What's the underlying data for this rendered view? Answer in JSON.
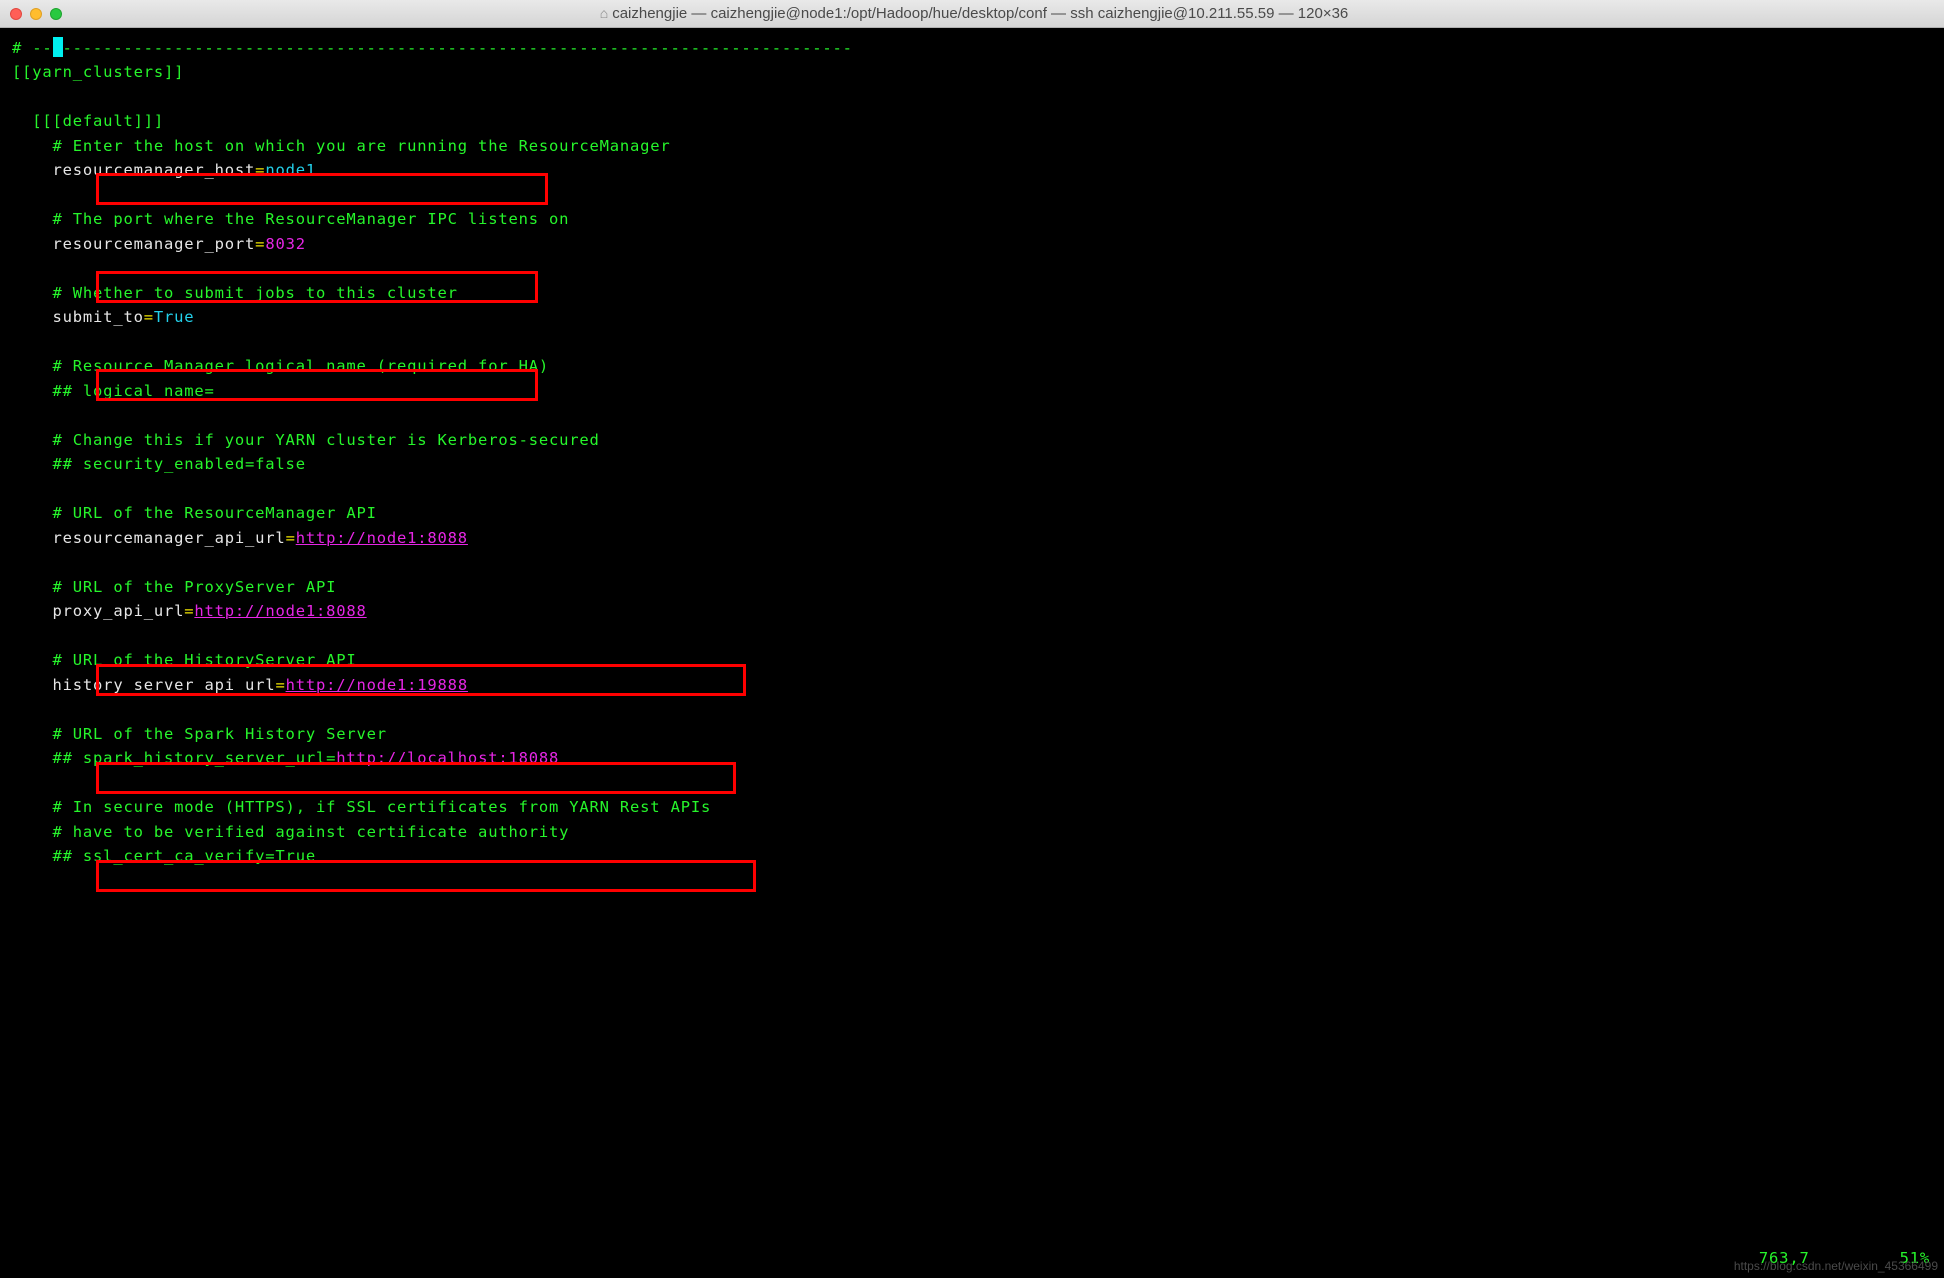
{
  "titlebar": {
    "title": "caizhengjie — caizhengjie@node1:/opt/Hadoop/hue/desktop/conf — ssh caizhengjie@10.211.55.59 — 120×36"
  },
  "terminal": {
    "hash_prefix": "# --",
    "dashes": "------------------------------------------------------------------------------",
    "section1": "[[yarn_clusters]]",
    "default_line": "  [[[default]]]",
    "comment_enter_host": "    # Enter the host on which you are running the ResourceManager",
    "rm_host_key": "    resourcemanager_host",
    "rm_host_val": "node1",
    "comment_rm_port": "    # The port where the ResourceManager IPC listens on",
    "rm_port_key": "    resourcemanager_port",
    "rm_port_val": "8032",
    "comment_submit": "    # Whether to submit jobs to this cluster",
    "submit_key": "    submit_to",
    "submit_val": "True",
    "comment_logical": "    # Resource Manager logical name (required for HA)",
    "logical_line": "    ## logical_name=",
    "comment_kerberos": "    # Change this if your YARN cluster is Kerberos-secured",
    "security_line": "    ## security_enabled=false",
    "comment_rm_api": "    # URL of the ResourceManager API",
    "rm_api_key": "    resourcemanager_api_url",
    "rm_api_url": "http://node1:8088",
    "comment_proxy": "    # URL of the ProxyServer API",
    "proxy_key": "    proxy_api_url",
    "proxy_url": "http://node1:8088",
    "comment_history": "    # URL of the HistoryServer API",
    "history_key": "    history_server_api_url",
    "history_url": "http://node1:19888",
    "comment_spark": "    # URL of the Spark History Server",
    "spark_prefix": "    ## spark_history_server_url=",
    "spark_url": "http://localhost:18088",
    "comment_ssl1": "    # In secure mode (HTTPS), if SSL certificates from YARN Rest APIs",
    "comment_ssl2": "    # have to be verified against certificate authority",
    "ssl_line": "    ## ssl_cert_ca_verify=True"
  },
  "statusbar": {
    "position": "763,7",
    "percent": "51%"
  },
  "watermark": "https://blog.csdn.net/weixin_45366499"
}
